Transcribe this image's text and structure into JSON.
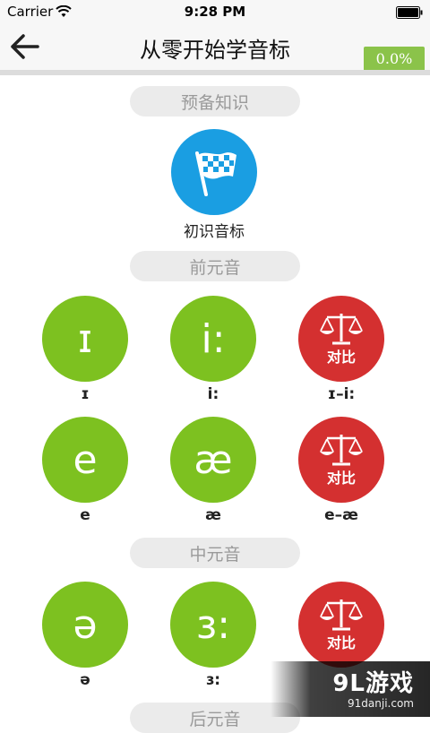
{
  "status_bar": {
    "carrier": "Carrier",
    "time": "9:28 PM"
  },
  "nav": {
    "title": "从零开始学音标",
    "progress": "0.0%"
  },
  "sections": {
    "prep": "预备知识",
    "front_vowels": "前元音",
    "central_vowels": "中元音",
    "back_vowels": "后元音"
  },
  "intro": {
    "label": "初识音标"
  },
  "front_items": [
    {
      "symbol": "ɪ",
      "label": "ɪ"
    },
    {
      "symbol": "i:",
      "label": "i:"
    },
    {
      "compare_text": "对比",
      "label": "ɪ–i:"
    },
    {
      "symbol": "e",
      "label": "e"
    },
    {
      "symbol": "æ",
      "label": "æ"
    },
    {
      "compare_text": "对比",
      "label": "e–æ"
    }
  ],
  "central_items": [
    {
      "symbol": "ə",
      "label": "ə"
    },
    {
      "symbol": "ɜ:",
      "label": "ɜ:"
    },
    {
      "compare_text": "对比"
    }
  ],
  "watermark": {
    "main": "9L游戏",
    "sub": "91danji.com"
  },
  "colors": {
    "green": "#7dc120",
    "blue": "#1a9ee2",
    "red": "#d43030",
    "badge": "#8bc34a"
  }
}
